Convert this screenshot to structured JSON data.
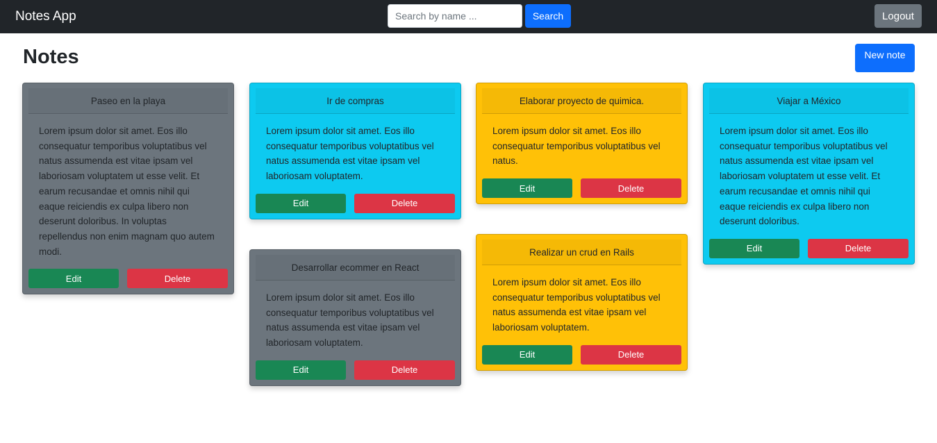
{
  "navbar": {
    "brand": "Notes App",
    "search_placeholder": "Search by name ...",
    "search_label": "Search",
    "logout_label": "Logout"
  },
  "main": {
    "title": "Notes",
    "new_note_label": "New note"
  },
  "colors": {
    "gray": "#6c757d",
    "cyan": "#0dcaf0",
    "yellow": "#ffc107",
    "edit": "#198754",
    "delete": "#dc3545",
    "primary": "#0d6efd"
  },
  "notes": [
    {
      "title": "Paseo en la playa",
      "body": "Lorem ipsum dolor sit amet. Eos illo consequatur temporibus voluptatibus vel natus assumenda est vitae ipsam vel laboriosam voluptatem ut esse velit. Et earum recusandae et omnis nihil qui eaque reiciendis ex culpa libero non deserunt doloribus. In voluptas repellendus non enim magnam quo autem modi.",
      "color": "gray",
      "edit_label": "Edit",
      "delete_label": "Delete"
    },
    {
      "title": "Ir de compras",
      "body": "Lorem ipsum dolor sit amet. Eos illo consequatur temporibus voluptatibus vel natus assumenda est vitae ipsam vel laboriosam voluptatem.",
      "color": "cyan",
      "edit_label": "Edit",
      "delete_label": "Delete"
    },
    {
      "title": "Desarrollar ecommer en React",
      "body": "Lorem ipsum dolor sit amet. Eos illo consequatur temporibus voluptatibus vel natus assumenda est vitae ipsam vel laboriosam voluptatem.",
      "color": "gray",
      "edit_label": "Edit",
      "delete_label": "Delete"
    },
    {
      "title": "Elaborar proyecto de quimica.",
      "body": "Lorem ipsum dolor sit amet. Eos illo consequatur temporibus voluptatibus vel natus.",
      "color": "yellow",
      "edit_label": "Edit",
      "delete_label": "Delete"
    },
    {
      "title": "Realizar un crud en Rails",
      "body": "Lorem ipsum dolor sit amet. Eos illo consequatur temporibus voluptatibus vel natus assumenda est vitae ipsam vel laboriosam voluptatem.",
      "color": "yellow",
      "edit_label": "Edit",
      "delete_label": "Delete"
    },
    {
      "title": "Viajar a México",
      "body": "Lorem ipsum dolor sit amet. Eos illo consequatur temporibus voluptatibus vel natus assumenda est vitae ipsam vel laboriosam voluptatem ut esse velit. Et earum recusandae et omnis nihil qui eaque reiciendis ex culpa libero non deserunt doloribus.",
      "color": "cyan",
      "edit_label": "Edit",
      "delete_label": "Delete"
    }
  ]
}
